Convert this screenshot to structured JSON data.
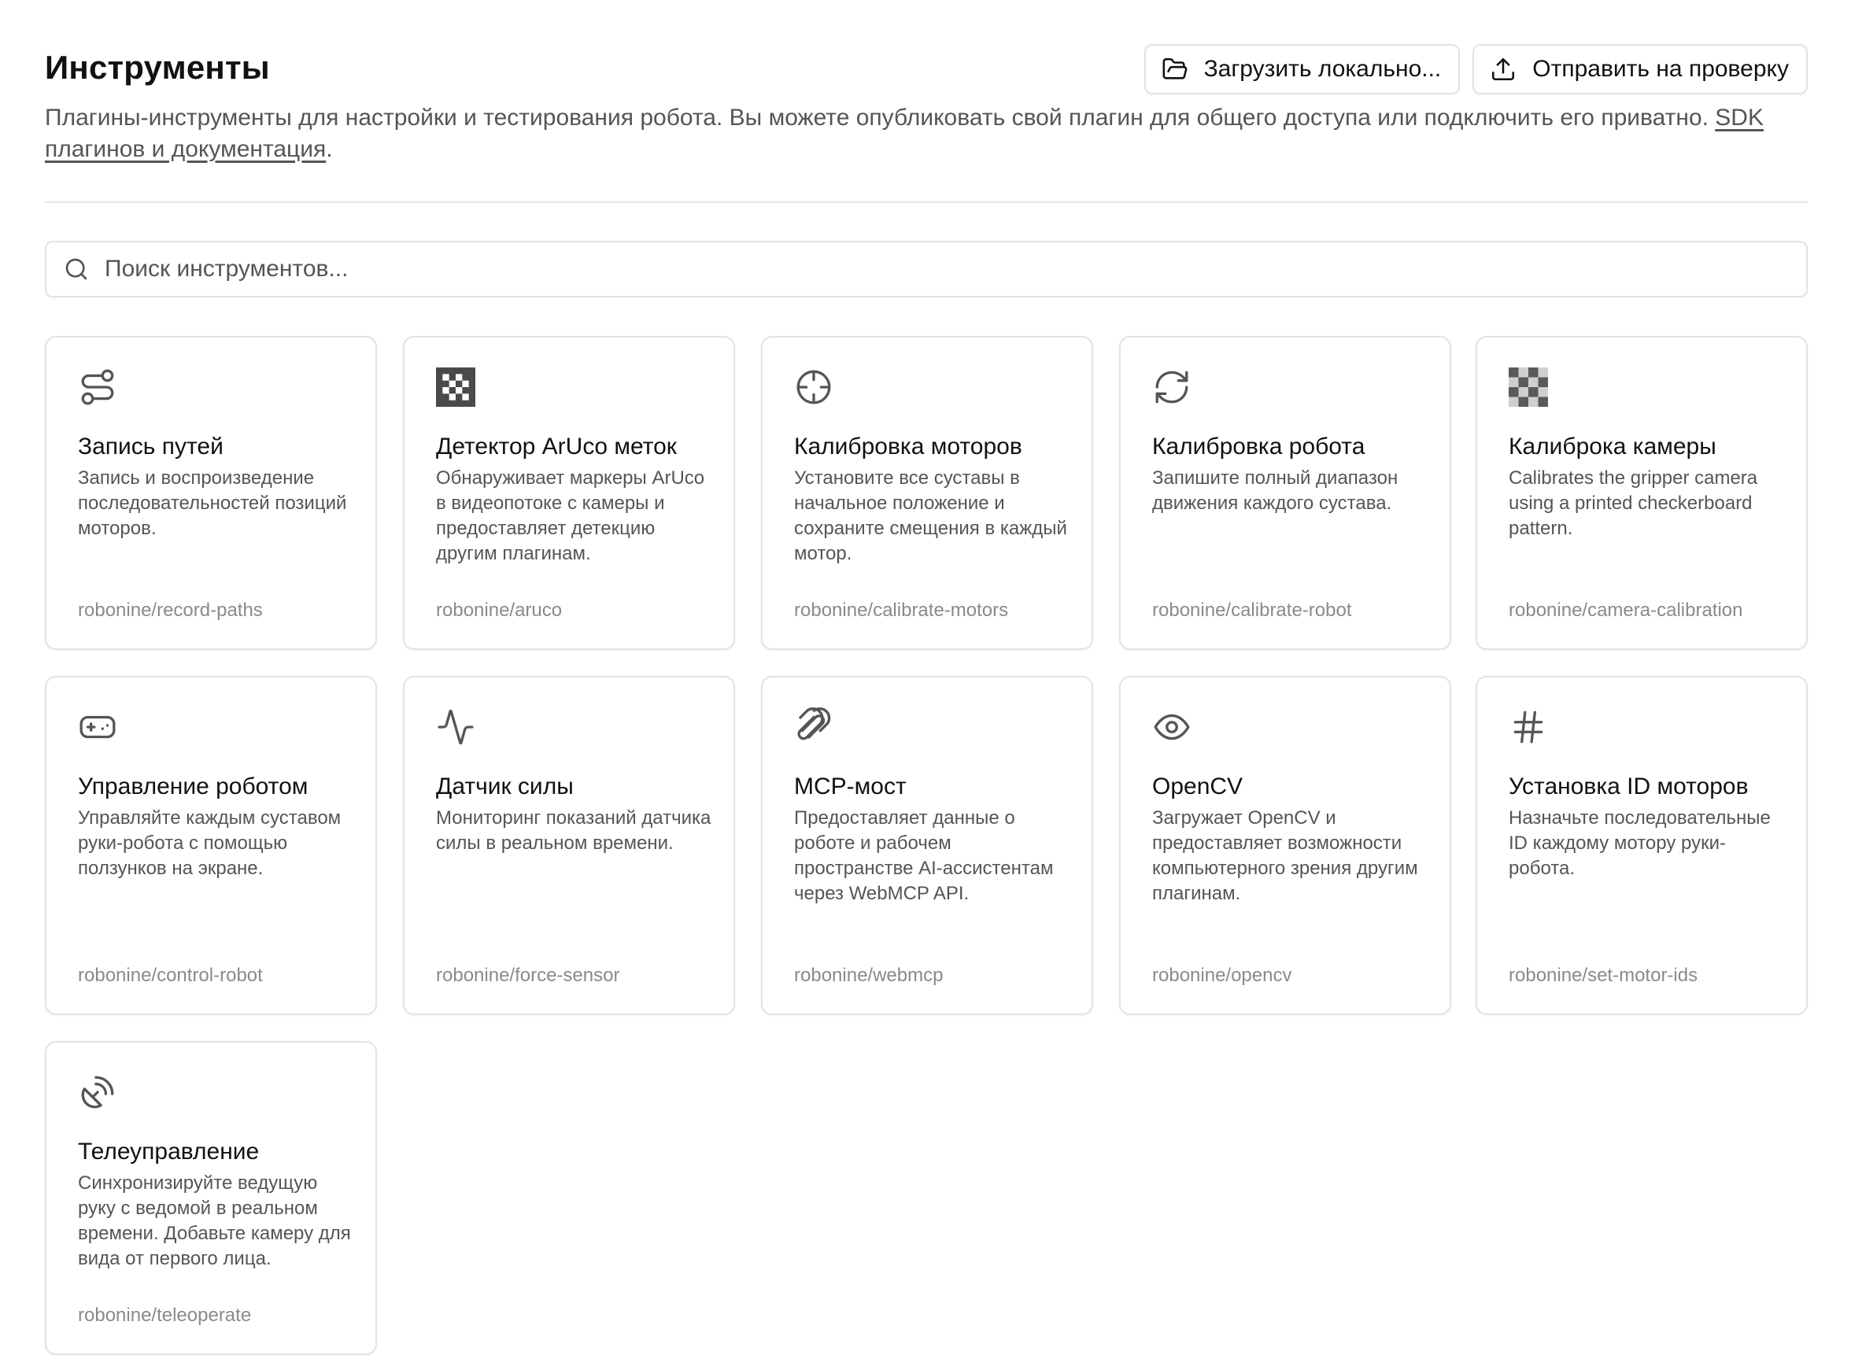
{
  "header": {
    "title": "Инструменты",
    "subtitle_text": "Плагины-инструменты для настройки и тестирования робота. Вы можете опубликовать свой плагин для общего доступа или подключить его приватно. ",
    "subtitle_link": "SDK плагинов и документация",
    "subtitle_end": ".",
    "load_local_label": "Загрузить локально...",
    "load_local_icon": "folder-open-icon",
    "submit_label": "Отправить на проверку",
    "submit_icon": "upload-icon"
  },
  "search": {
    "placeholder": "Поиск инструментов...",
    "value": "",
    "icon": "search-icon"
  },
  "tools": [
    {
      "name": "Запись путей",
      "description": "Запись и воспроизведение последовательностей позиций моторов.",
      "repo": "robonine/record-paths",
      "icon": "route-icon"
    },
    {
      "name": "Детектор ArUco меток",
      "description": "Обнаруживает маркеры ArUco в видеопотоке с камеры и предоставляет детекцию другим плагинам.",
      "repo": "robonine/aruco",
      "icon": "aruco-marker-icon"
    },
    {
      "name": "Калибровка моторов",
      "description": "Установите все суставы в начальное положение и сохраните смещения в каждый мотор.",
      "repo": "robonine/calibrate-motors",
      "icon": "crosshair-icon"
    },
    {
      "name": "Калибровка робота",
      "description": "Запишите полный диапазон движения каждого сустава.",
      "repo": "robonine/calibrate-robot",
      "icon": "refresh-icon"
    },
    {
      "name": "Калиброка камеры",
      "description": "Calibrates the gripper camera using a printed checkerboard pattern.",
      "repo": "robonine/camera-calibration",
      "icon": "checkerboard-icon"
    },
    {
      "name": "Управление роботом",
      "description": "Управляйте каждым суставом руки-робота с помощью ползунков на экране.",
      "repo": "robonine/control-robot",
      "icon": "gamepad-icon"
    },
    {
      "name": "Датчик силы",
      "description": "Мониторинг показаний датчика силы в реальном времени.",
      "repo": "robonine/force-sensor",
      "icon": "activity-icon"
    },
    {
      "name": "MCP-мост",
      "description": "Предоставляет данные о роботе и рабочем пространстве AI-ассистентам через WebMCP API.",
      "repo": "robonine/webmcp",
      "icon": "paperclip-icon"
    },
    {
      "name": "OpenCV",
      "description": "Загружает OpenCV и предоставляет возможности компьютерного зрения другим плагинам.",
      "repo": "robonine/opencv",
      "icon": "eye-icon"
    },
    {
      "name": "Установка ID моторов",
      "description": "Назначьте последовательные ID каждому мотору руки-робота.",
      "repo": "robonine/set-motor-ids",
      "icon": "hash-icon"
    },
    {
      "name": "Телеуправление",
      "description": "Синхронизируйте ведущую руку с ведомой в реальном времени. Добавьте камеру для вида от первого лица.",
      "repo": "robonine/teleoperate",
      "icon": "satellite-dish-icon"
    }
  ],
  "colors": {
    "text_primary": "#111111",
    "text_secondary": "#555555",
    "text_muted": "#8a8a8a",
    "border": "#e3e3e3"
  }
}
